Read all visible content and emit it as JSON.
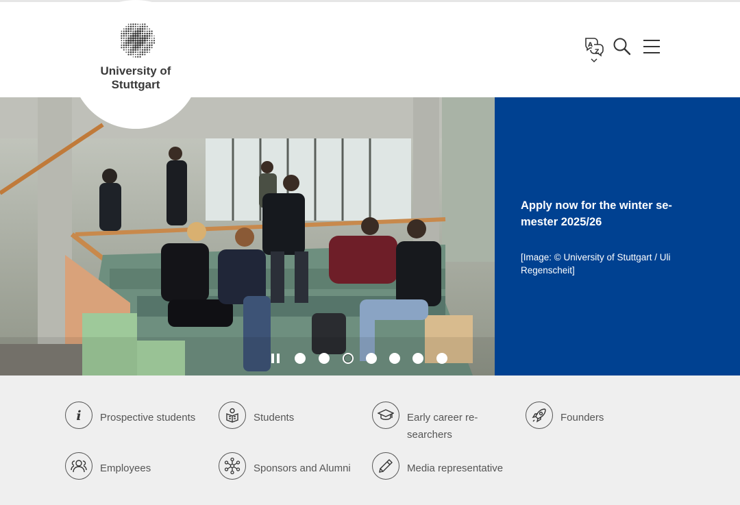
{
  "header": {
    "logo_line1": "University of",
    "logo_line2": "Stuttgart",
    "icons": [
      "language-icon",
      "search-icon",
      "menu-icon"
    ]
  },
  "hero": {
    "title": "Apply now for the winter se-mester 2025/26",
    "credit": "[Image: © University of Stuttgart / Uli Regenscheit]",
    "panel_color": "#004191",
    "slides_count": 7,
    "active_slide": 3
  },
  "quicklinks": [
    {
      "label": "Prospective students",
      "icon": "info-icon"
    },
    {
      "label": "Students",
      "icon": "student-icon"
    },
    {
      "label": "Early career re-searchers",
      "icon": "mortarboard-icon"
    },
    {
      "label": "Founders",
      "icon": "rocket-icon"
    },
    {
      "label": "Employees",
      "icon": "people-icon"
    },
    {
      "label": "Sponsors and Alumni",
      "icon": "network-icon"
    },
    {
      "label": "Media representative",
      "icon": "pencil-icon"
    }
  ],
  "colors": {
    "brand_blue": "#004191",
    "quicklinks_bg": "#efefef",
    "text_gray": "#555555"
  }
}
